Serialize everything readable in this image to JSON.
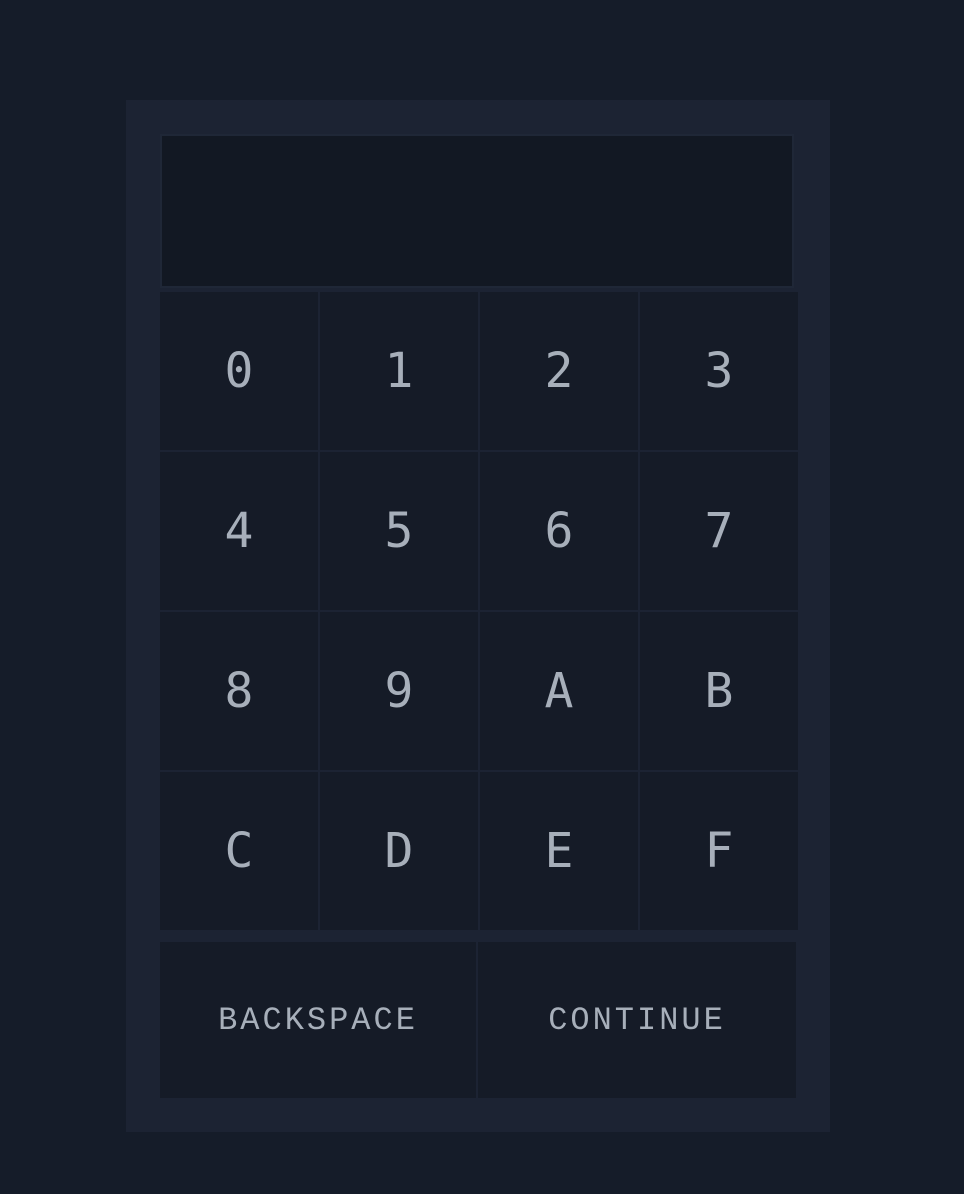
{
  "display": {
    "value": ""
  },
  "keypad": {
    "keys": [
      "0",
      "1",
      "2",
      "3",
      "4",
      "5",
      "6",
      "7",
      "8",
      "9",
      "A",
      "B",
      "C",
      "D",
      "E",
      "F"
    ]
  },
  "actions": {
    "backspace_label": "BACKSPACE",
    "continue_label": "CONTINUE"
  },
  "colors": {
    "background": "#151c29",
    "panel": "#1c2333",
    "key": "#151b27",
    "display": "#121823",
    "text": "#a7afba"
  }
}
